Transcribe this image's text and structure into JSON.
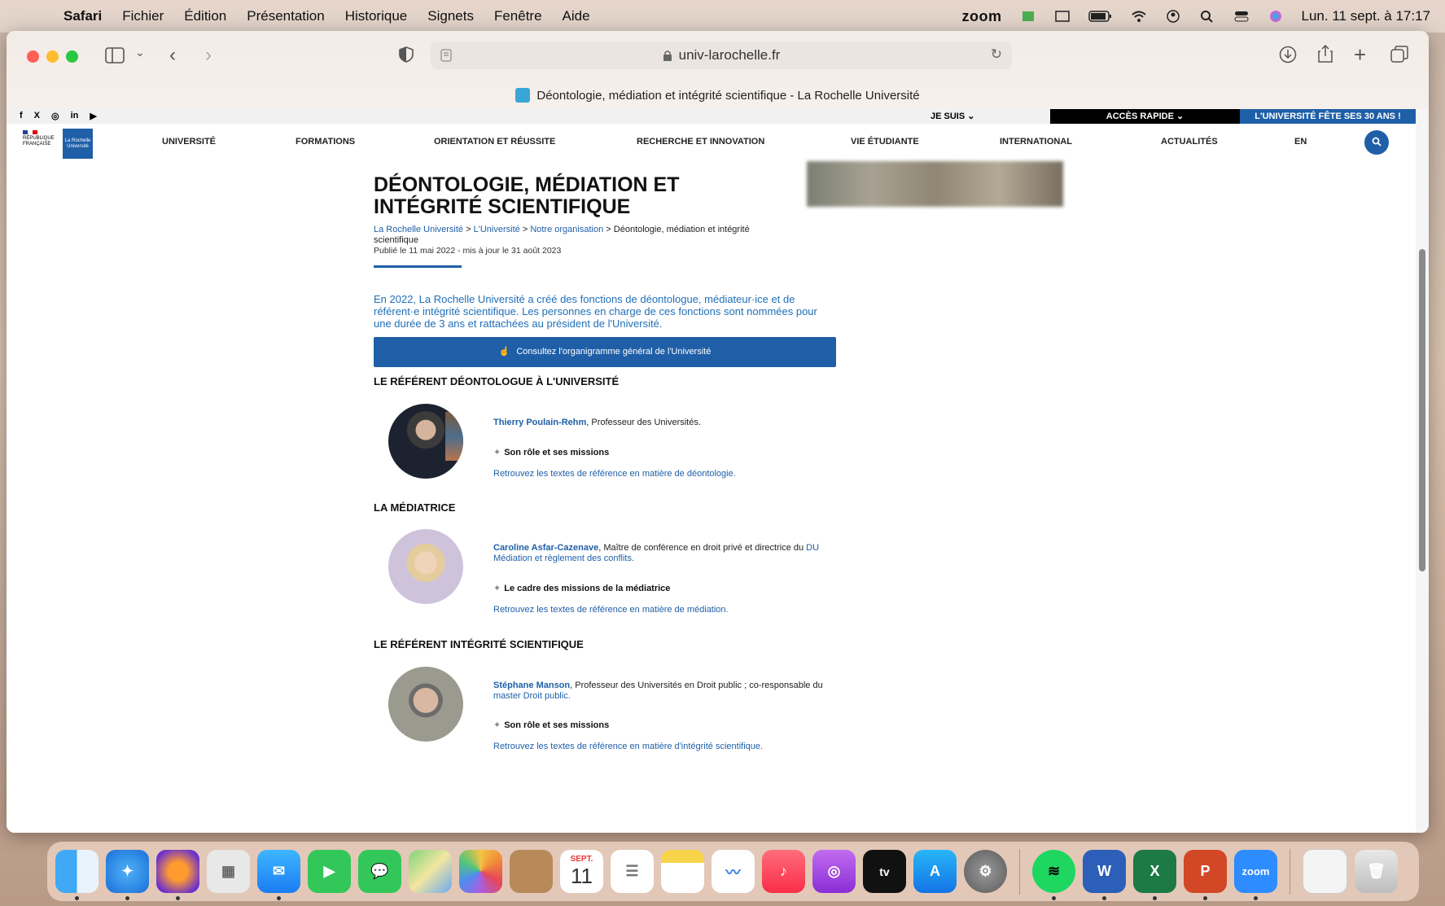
{
  "menubar": {
    "app": "Safari",
    "items": [
      "Fichier",
      "Édition",
      "Présentation",
      "Historique",
      "Signets",
      "Fenêtre",
      "Aide"
    ],
    "zoom": "zoom",
    "datetime": "Lun. 11 sept. à 17:17"
  },
  "browser": {
    "url": "univ-larochelle.fr",
    "tab_title": "Déontologie, médiation et intégrité scientifique - La Rochelle Université"
  },
  "site": {
    "social": [
      "f",
      "X",
      "◎",
      "in",
      "▶"
    ],
    "je_suis": "JE SUIS ⌄",
    "acces_rapide": "ACCÈS RAPIDE ⌄",
    "anniversary": "L'UNIVERSITÉ FÊTE SES 30 ANS !",
    "logo_rf": "RÉPUBLIQUE FRANÇAISE",
    "logo_lr": "La Rochelle Université",
    "nav": [
      "UNIVERSITÉ",
      "FORMATIONS",
      "ORIENTATION ET RÉUSSITE",
      "RECHERCHE ET INNOVATION",
      "VIE ÉTUDIANTE",
      "INTERNATIONAL",
      "ACTUALITÉS",
      "EN"
    ],
    "title": "DÉONTOLOGIE, MÉDIATION ET INTÉGRITÉ SCIENTIFIQUE",
    "breadcrumb": {
      "home": "La Rochelle Université",
      "sep": ">",
      "level2": "L'Université",
      "level3": "Notre organisation",
      "current": "Déontologie, médiation et intégrité scientifique"
    },
    "published": "Publié le 11 mai 2022 - mis à jour le 31 août 2023",
    "intro": "En 2022, La Rochelle Université a créé des fonctions de déontologue, médiateur·ice et de référent·e intégrité scientifique. Les personnes en charge de ces fonctions sont nommées pour une durée de 3 ans et rattachées au président de l'Université.",
    "org_button": "Consultez l'organigramme général de l'Université",
    "sections": [
      {
        "title": "LE RÉFÉRENT DÉONTOLOGUE À L'UNIVERSITÉ",
        "name": "Thierry Poulain-Rehm",
        "desc": ", Professeur des Universités.",
        "desc_link": "",
        "mission": "Son rôle et ses missions",
        "reflink": "Retrouvez les textes de référence en matière de déontologie."
      },
      {
        "title": "LA MÉDIATRICE",
        "name": "Caroline Asfar-Cazenave",
        "desc": ", Maître de conférence en droit privé et directrice du ",
        "desc_link": "DU Médiation et règlement des conflits.",
        "mission": "Le cadre des missions de la médiatrice",
        "reflink": "Retrouvez les textes de référence en matière de médiation."
      },
      {
        "title": "LE RÉFÉRENT INTÉGRITÉ SCIENTIFIQUE",
        "name": "Stéphane Manson",
        "desc": ", Professeur des Universités en Droit public ; co-responsable du ",
        "desc_link": "master Droit public.",
        "mission": "Son rôle et ses missions",
        "reflink": "Retrouvez les textes de référence en matière d'intégrité scientifique."
      }
    ]
  },
  "dock": {
    "calendar_month": "SEPT.",
    "calendar_day": "11",
    "zoom_label": "zoom",
    "items": [
      "finder",
      "safari",
      "firefox",
      "launchpad",
      "mail",
      "facetime",
      "messages",
      "maps",
      "photos",
      "contacts",
      "calendar",
      "reminders",
      "notes",
      "freeform",
      "music",
      "podcasts",
      "appletv",
      "appstore",
      "settings",
      "spotify",
      "word",
      "excel",
      "powerpoint",
      "zoom",
      "preview",
      "trash"
    ]
  },
  "colors": {
    "brand_blue": "#1f5fa8",
    "link_blue": "#1f6fb8"
  }
}
